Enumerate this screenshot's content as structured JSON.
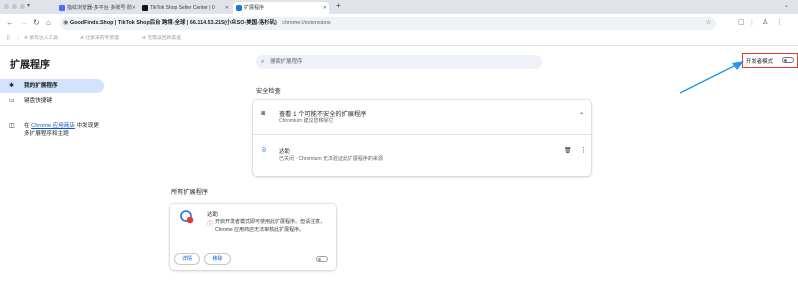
{
  "browser": {
    "tabs": [
      {
        "title": "指纹浏览器-多平台·多账号·防",
        "active": false
      },
      {
        "title": "TikTok Shop Seller Center | 0",
        "active": false
      },
      {
        "title": "扩展程序",
        "active": true
      }
    ],
    "new_tab_label": "+",
    "address": {
      "site_label": "GoodFinds.Shop | TikTok Shop后台 跨境-全球 | 66.114.53.215(小众SO-美国-洛杉矶)",
      "url": "chrome://extensions"
    },
    "bookmarks": [
      "紫鸟达人工具",
      "壮紫采购专管理",
      "无需返回新渠道"
    ]
  },
  "page": {
    "title": "扩展程序",
    "search_placeholder": "搜索扩展程序",
    "dev_mode_label": "开发者模式",
    "dev_mode_enabled": false,
    "sidebar": {
      "items": [
        {
          "label": "我的扩展程序",
          "selected": true
        },
        {
          "label": "键盘快捷键",
          "selected": false
        }
      ],
      "promo_prefix": "在 ",
      "promo_link": "Chrome 应用商店",
      "promo_suffix": " 中发现更多扩展程序和主题"
    },
    "safety": {
      "heading": "安全检查",
      "summary_title": "查看 1 个可能不安全的扩展程序",
      "summary_subtitle": "Chromium 建议您移除它",
      "item_name": "达助",
      "item_desc": "已关闭 · Chromium 无法验证此扩展程序的来源"
    },
    "all": {
      "heading": "所有扩展程序",
      "extension_name": "达助",
      "warning": "开启开发者模式即可使用此扩展程序。但请注意，Chrome 应用商店无法审核此扩展程序。",
      "details_label": "详情",
      "remove_label": "移除",
      "enabled": false
    }
  },
  "colors": {
    "accent": "#0b57d0",
    "annotation": "#e53935",
    "arrow": "#2196f3"
  }
}
